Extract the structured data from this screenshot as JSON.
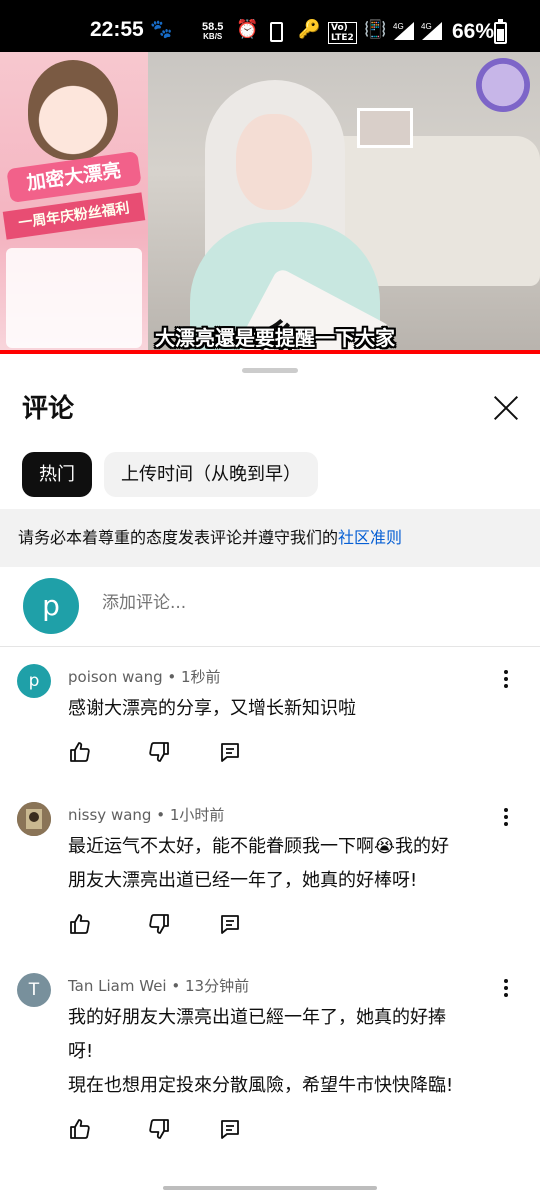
{
  "status_bar": {
    "time": "22:55",
    "net_speed_value": "58.5",
    "net_speed_unit": "KB/S",
    "battery": "66%",
    "battery_level": 0.66,
    "icons": [
      "pets-icon",
      "alarm-icon",
      "phone-icon",
      "key-icon",
      "volte-icon",
      "vibrate-icon",
      "signal-4g-icon",
      "signal-4g-icon",
      "battery-icon"
    ]
  },
  "video": {
    "subtitle": "大漂亮還是要提醒一下大家",
    "poster_banner": "加密大漂亮",
    "poster_subbanner": "一周年庆粉丝福利",
    "pillow_text": "你",
    "progress": 1.0
  },
  "sheet": {
    "title": "评论",
    "chips": [
      {
        "label": "热门",
        "active": true
      },
      {
        "label": "上传时间（从晚到早）",
        "active": false
      }
    ],
    "notice_text": "请务必本着尊重的态度发表评论并遵守我们的",
    "notice_link": "社区准则",
    "my_avatar_letter": "p",
    "add_placeholder": "添加评论..."
  },
  "comments": [
    {
      "author": "poison wang",
      "time": "1秒前",
      "avatar_letter": "p",
      "avatar_color": "#1fa0a8",
      "lines": [
        "感谢大漂亮的分享，又增长新知识啦"
      ]
    },
    {
      "author": "nissy wang",
      "time": "1小时前",
      "avatar_letter": "",
      "avatar_color": "#6b5a45",
      "lines": [
        "最近运气不太好，能不能眷顾我一下啊😭我的好",
        "朋友大漂亮出道已经一年了，她真的好棒呀!"
      ]
    },
    {
      "author": "Tan Liam Wei",
      "time": "13分钟前",
      "avatar_letter": "T",
      "avatar_color": "#78909c",
      "lines": [
        "我的好朋友大漂亮出道已經一年了，她真的好捧",
        "呀!",
        "現在也想用定投來分散風險，希望牛市快快降臨!"
      ]
    }
  ]
}
